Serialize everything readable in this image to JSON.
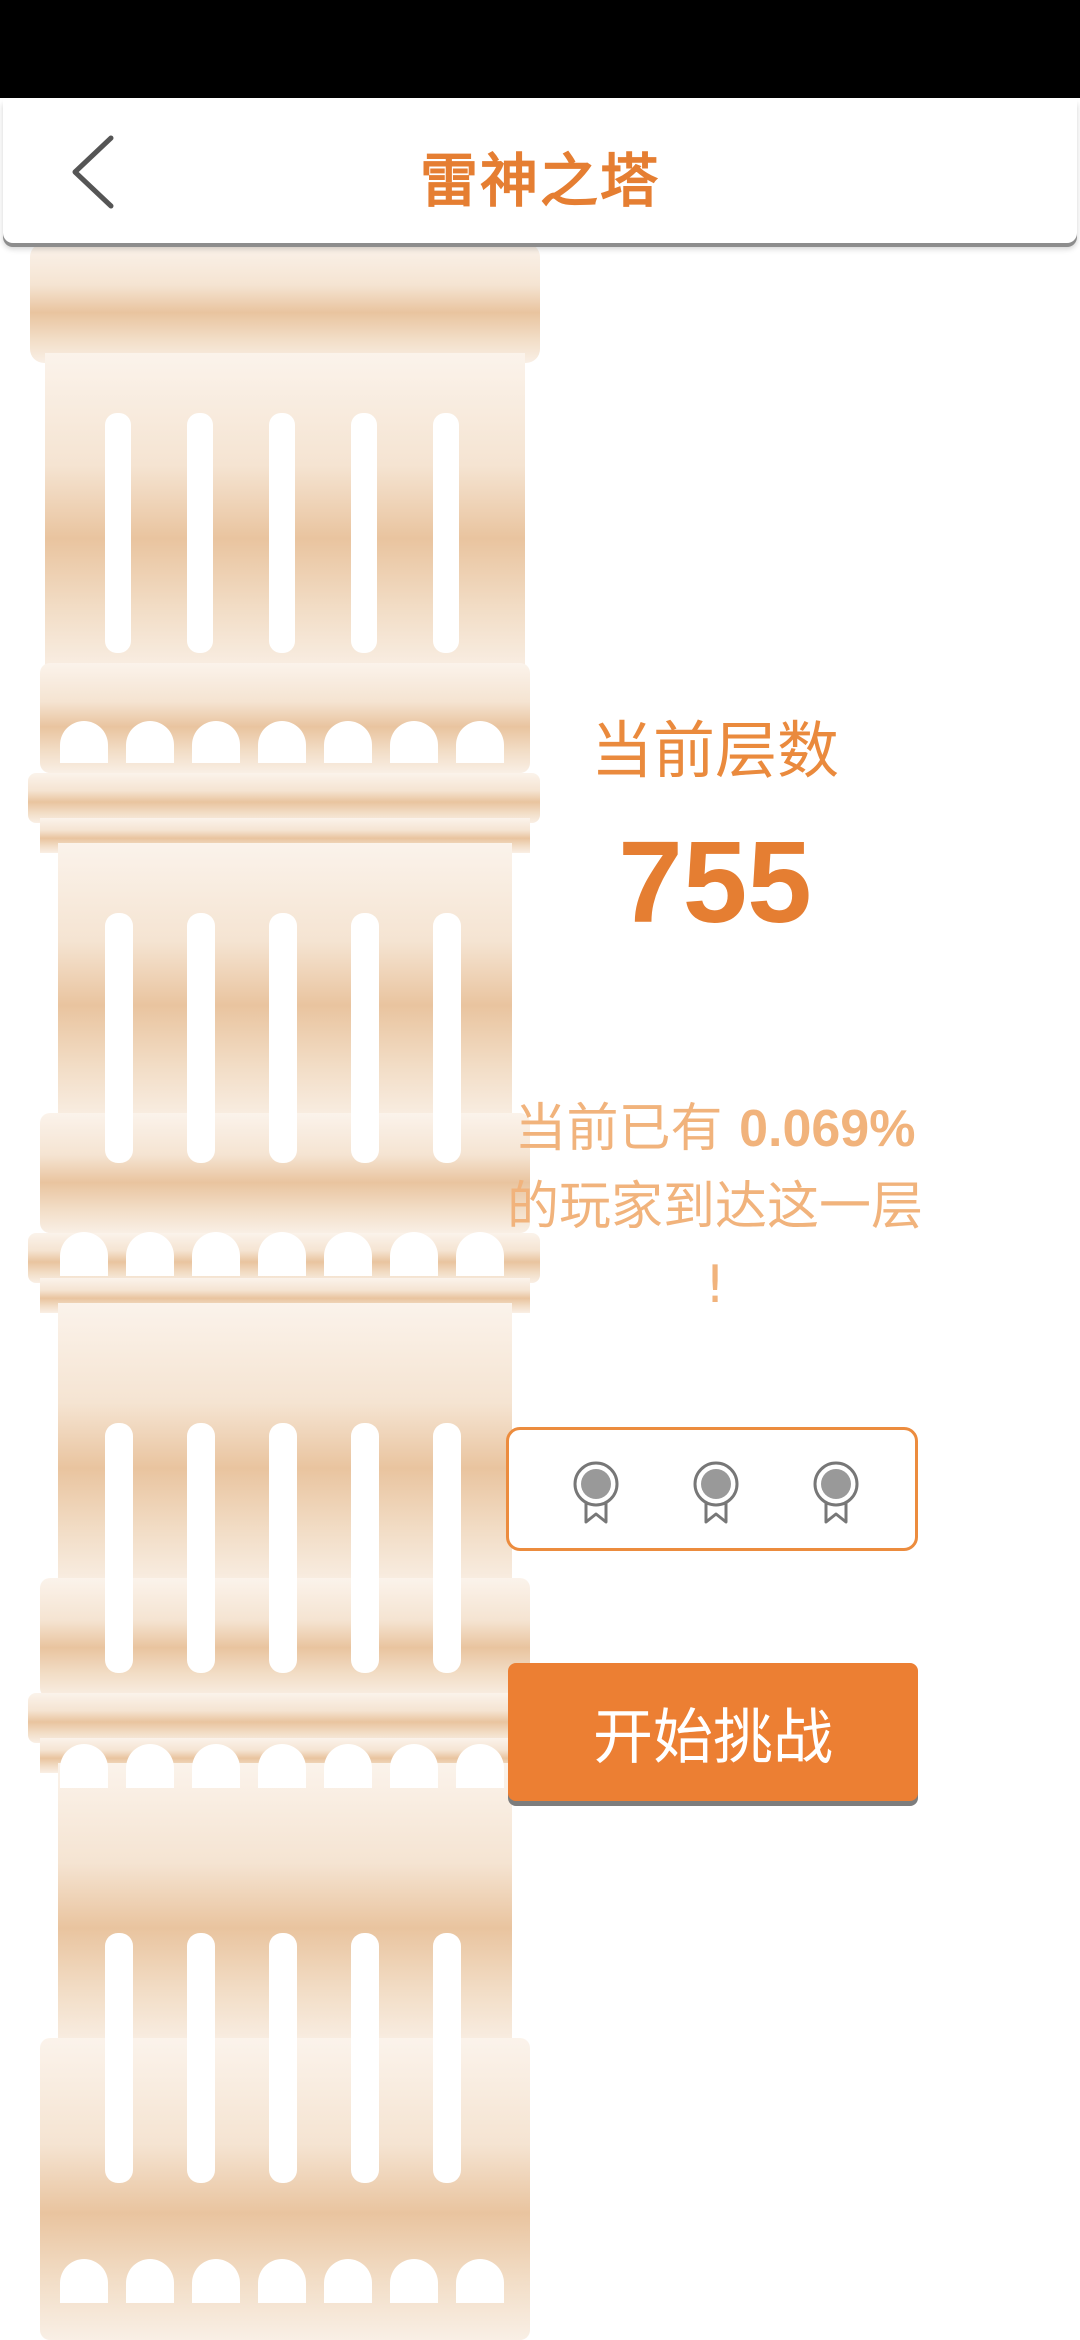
{
  "header": {
    "title": "雷神之塔",
    "back_icon": "chevron-left-icon"
  },
  "progress": {
    "label": "当前层数",
    "floor": "755"
  },
  "reach": {
    "prefix": "当前已有 ",
    "percent": "0.069%",
    "line2": "的玩家到达这一层",
    "line3": "!"
  },
  "medals": [
    {
      "icon": "medal-icon",
      "earned": false
    },
    {
      "icon": "medal-icon",
      "earned": false
    },
    {
      "icon": "medal-icon",
      "earned": false
    }
  ],
  "actions": {
    "start_label": "开始挑战"
  },
  "colors": {
    "accent": "#e57e32",
    "button": "#ec7f33",
    "muted_text": "#f1b37c",
    "tower": "#e9c49f"
  }
}
